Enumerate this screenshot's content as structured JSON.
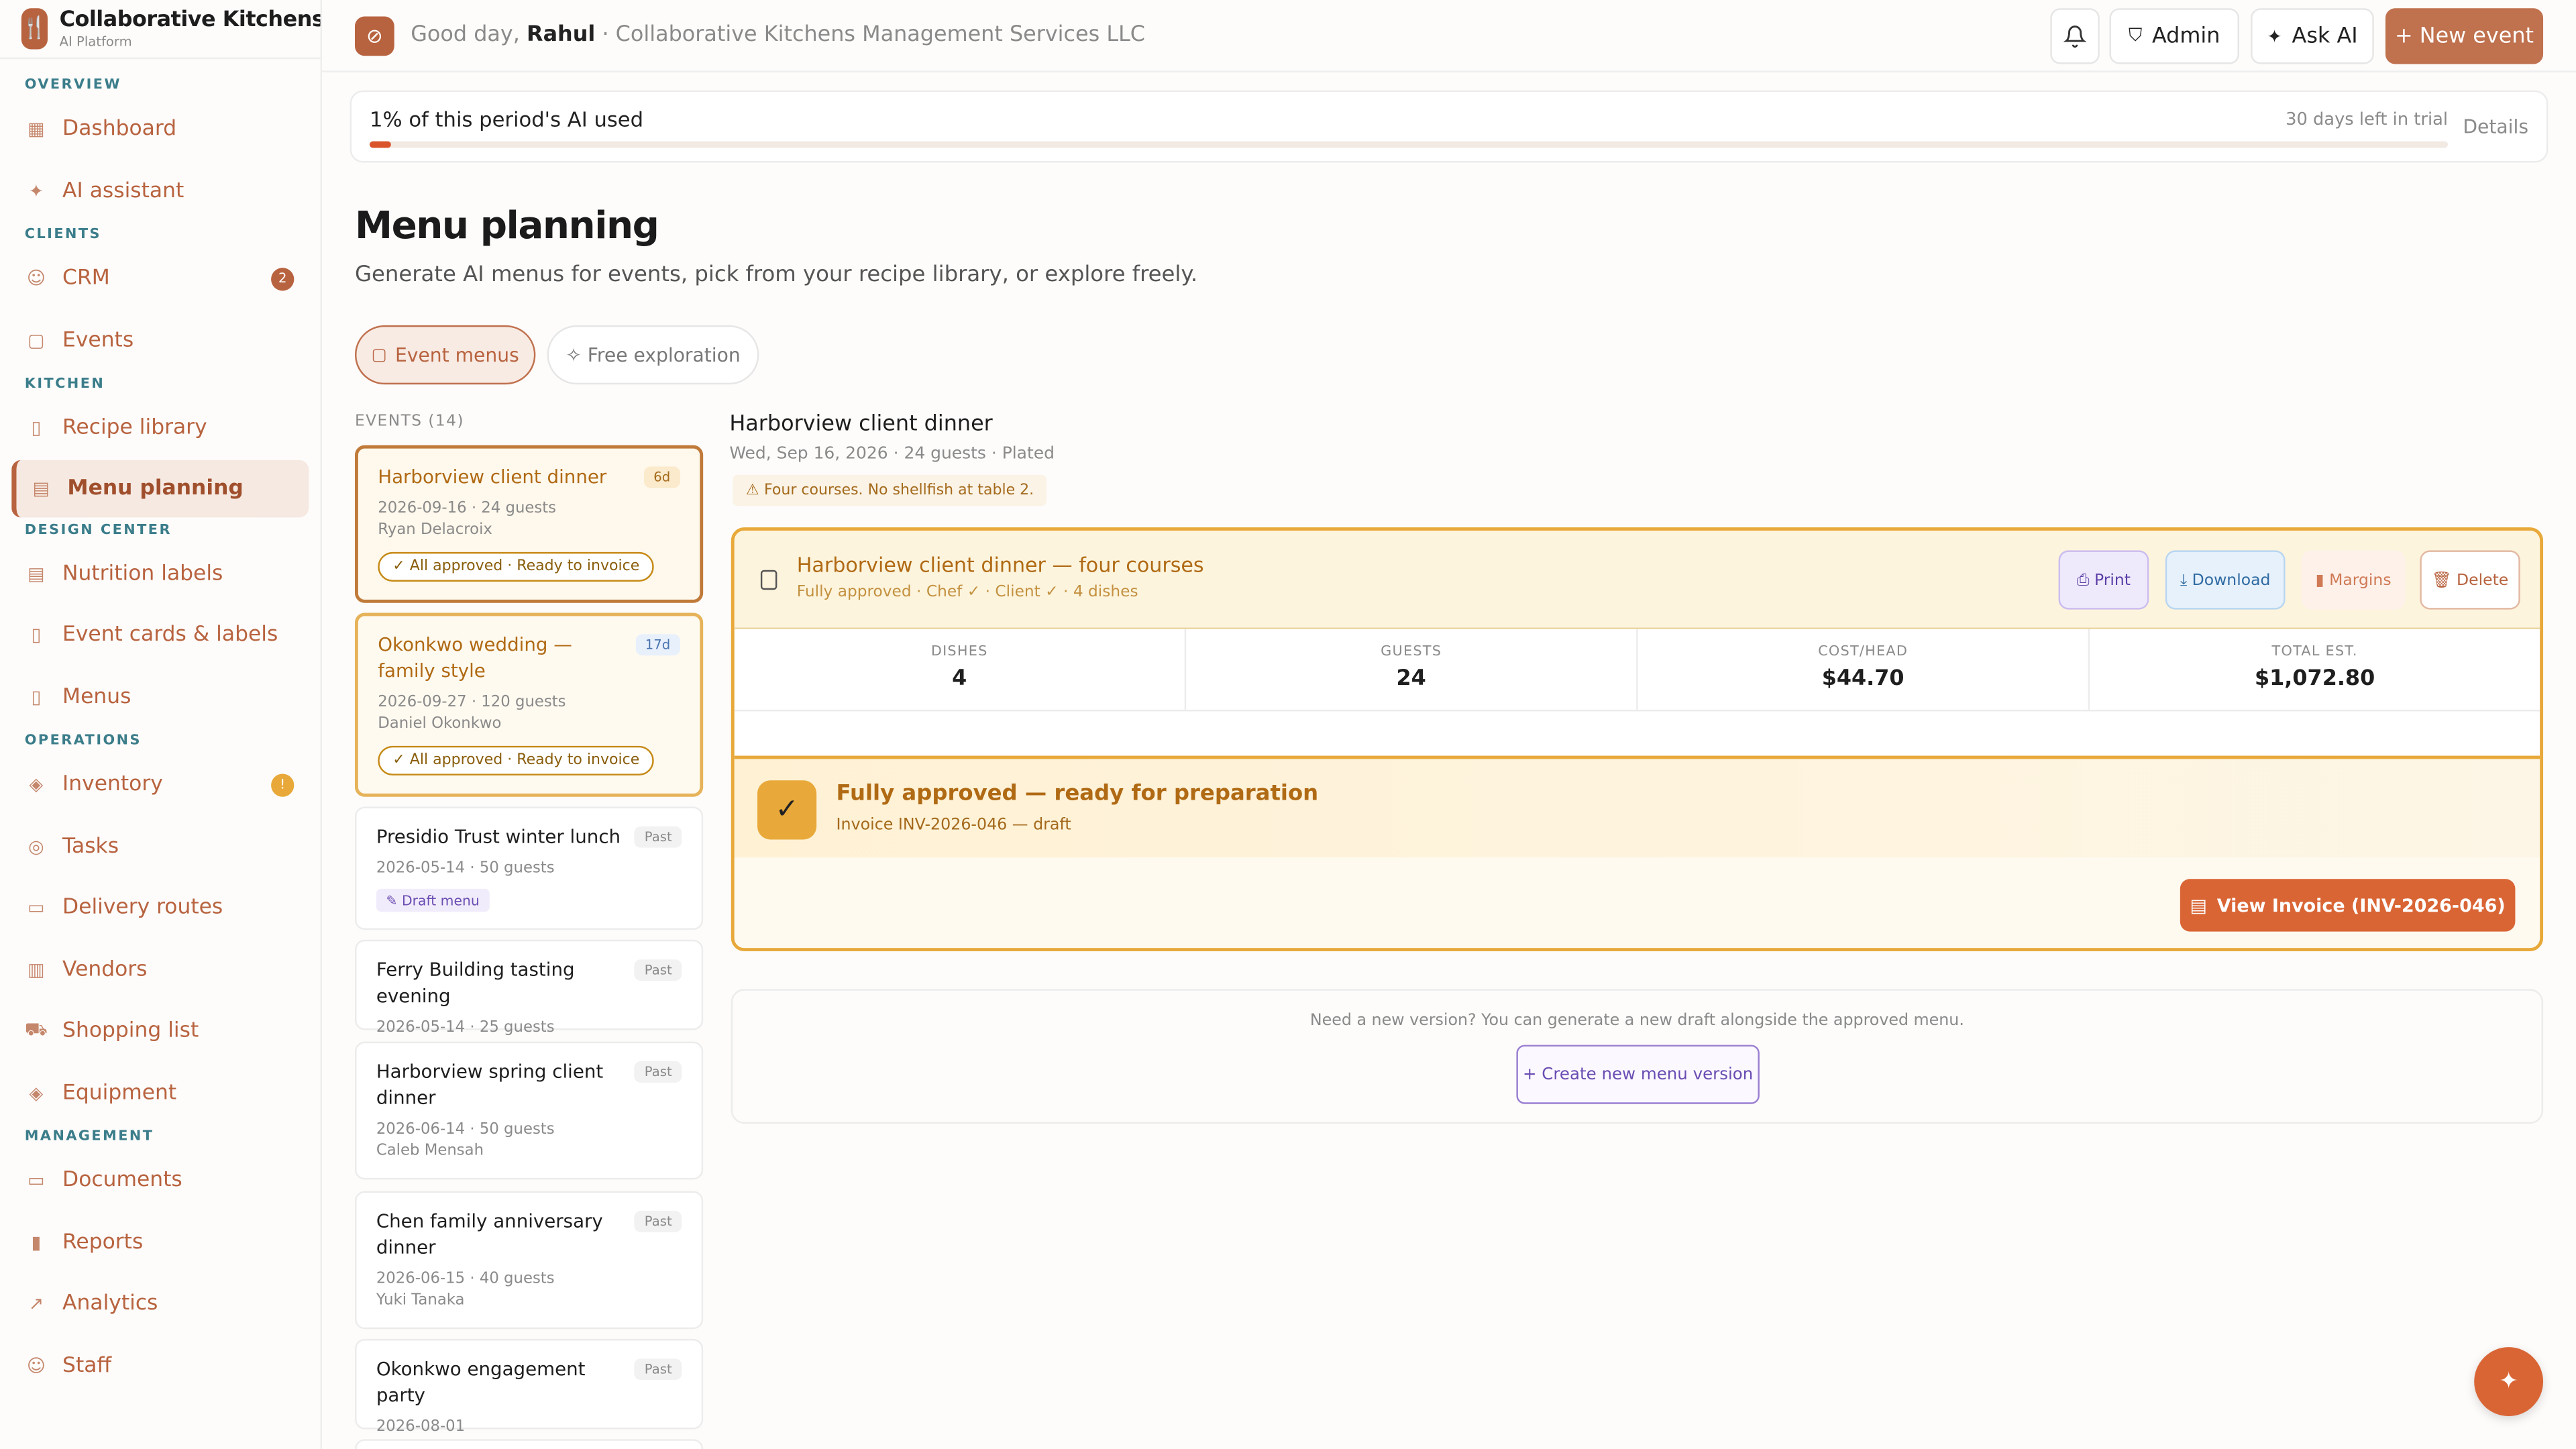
{
  "brand": {
    "name": "Collaborative Kitchens",
    "tagline": "AI Platform"
  },
  "sidebar": {
    "overview_label": "OVERVIEW",
    "dashboard": "Dashboard",
    "ai_assistant": "AI assistant",
    "clients_label": "CLIENTS",
    "crm": "CRM",
    "crm_badge": "2",
    "events": "Events",
    "kitchen_label": "KITCHEN",
    "recipe_library": "Recipe library",
    "menu_planning": "Menu planning",
    "design_label": "DESIGN CENTER",
    "nutrition_labels": "Nutrition labels",
    "event_cards": "Event cards & labels",
    "menus": "Menus",
    "operations_label": "OPERATIONS",
    "inventory": "Inventory",
    "inventory_badge": "!",
    "tasks": "Tasks",
    "delivery_routes": "Delivery routes",
    "vendors": "Vendors",
    "shopping_list": "Shopping list",
    "equipment": "Equipment",
    "management_label": "MANAGEMENT",
    "documents": "Documents",
    "reports": "Reports",
    "analytics": "Analytics",
    "staff": "Staff"
  },
  "topbar": {
    "greeting": "Good day,",
    "user": "Rahul",
    "company": "· Collaborative Kitchens Management Services LLC",
    "admin": "Admin",
    "ask_ai": "Ask AI",
    "new_event": "+ New event"
  },
  "usage": {
    "label": "1% of this period's AI used",
    "trial": "30 days left in trial",
    "details": "Details",
    "percent": 1
  },
  "page": {
    "title": "Menu planning",
    "subtitle": "Generate AI menus for events, pick from your recipe library, or explore freely.",
    "tab_event": "Event menus",
    "tab_free": "✧ Free exploration",
    "events_header": "EVENTS (14)"
  },
  "events": [
    {
      "title": "Harborview client dinner",
      "tag": "6d",
      "meta": "2026-09-16 · 24 guests",
      "person": "Ryan Delacroix",
      "status": "✓ All approved · Ready to invoice"
    },
    {
      "title": "Okonkwo wedding — family style",
      "tag": "17d",
      "meta": "2026-09-27 · 120 guests",
      "person": "Daniel Okonkwo",
      "status": "✓ All approved · Ready to invoice"
    },
    {
      "title": "Presidio Trust winter lunch",
      "tag": "Past",
      "meta": "2026-05-14 · 50 guests",
      "status": "✎ Draft menu"
    },
    {
      "title": "Ferry Building tasting evening",
      "tag": "Past",
      "meta": "2026-05-14 · 25 guests"
    },
    {
      "title": "Harborview spring client dinner",
      "tag": "Past",
      "meta": "2026-06-14 · 50 guests",
      "person": "Caleb Mensah"
    },
    {
      "title": "Chen family anniversary dinner",
      "tag": "Past",
      "meta": "2026-06-15 · 40 guests",
      "person": "Yuki Tanaka"
    },
    {
      "title": "Okonkwo engagement party",
      "tag": "Past",
      "meta": "2026-08-01"
    }
  ],
  "detail": {
    "title": "Harborview client dinner",
    "meta": "Wed, Sep 16, 2026 · 24 guests · Plated",
    "note": "Four courses. No shellfish at table 2.",
    "menu_title": "Harborview client dinner — four courses",
    "menu_sub": "Fully approved · Chef ✓ · Client ✓ · 4 dishes",
    "print": "Print",
    "download": "Download",
    "margins": "Margins",
    "delete": "Delete",
    "stats": [
      {
        "label": "DISHES",
        "value": "4"
      },
      {
        "label": "GUESTS",
        "value": "24"
      },
      {
        "label": "COST/HEAD",
        "value": "$44.70"
      },
      {
        "label": "TOTAL EST.",
        "value": "$1,072.80"
      }
    ],
    "approved_title": "Fully approved — ready for preparation",
    "approved_sub": "Invoice INV-2026-046 — draft",
    "view_invoice": "View Invoice (INV-2026-046)",
    "new_version_text": "Need a new version? You can generate a new draft alongside the approved menu.",
    "new_version_btn": "+ Create new menu version"
  },
  "colors": {
    "accent": "#b8633f",
    "approved": "#e8a93a",
    "cta": "#d96535"
  }
}
